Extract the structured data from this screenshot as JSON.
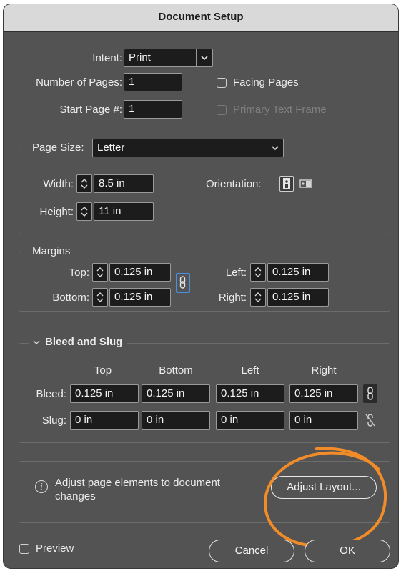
{
  "title": "Document Setup",
  "intent": {
    "label": "Intent:",
    "value": "Print"
  },
  "pages": {
    "label": "Number of Pages:",
    "value": "1"
  },
  "start_page": {
    "label": "Start Page #:",
    "value": "1"
  },
  "facing_pages": {
    "label": "Facing Pages",
    "checked": false
  },
  "primary_text_frame": {
    "label": "Primary Text Frame",
    "checked": false,
    "enabled": false
  },
  "page_size": {
    "label": "Page Size:",
    "value": "Letter"
  },
  "width": {
    "label": "Width:",
    "value": "8.5 in"
  },
  "height": {
    "label": "Height:",
    "value": "11 in"
  },
  "orientation": {
    "label": "Orientation:",
    "selected": "portrait"
  },
  "margins": {
    "legend": "Margins",
    "top": {
      "label": "Top:",
      "value": "0.125 in"
    },
    "bottom": {
      "label": "Bottom:",
      "value": "0.125 in"
    },
    "left": {
      "label": "Left:",
      "value": "0.125 in"
    },
    "right": {
      "label": "Right:",
      "value": "0.125 in"
    },
    "linked": true
  },
  "bleed_slug": {
    "legend": "Bleed and Slug",
    "columns": [
      "Top",
      "Bottom",
      "Left",
      "Right"
    ],
    "bleed": {
      "label": "Bleed:",
      "values": [
        "0.125 in",
        "0.125 in",
        "0.125 in",
        "0.125 in"
      ],
      "linked": true
    },
    "slug": {
      "label": "Slug:",
      "values": [
        "0 in",
        "0 in",
        "0 in",
        "0 in"
      ],
      "linked": false
    }
  },
  "adjust": {
    "info_line1": "Adjust page elements to document",
    "info_line2": "changes",
    "button": "Adjust Layout..."
  },
  "preview": {
    "label": "Preview",
    "checked": false
  },
  "buttons": {
    "cancel": "Cancel",
    "ok": "OK"
  },
  "colors": {
    "dialog_bg": "#535353",
    "field_bg": "#1c1c1c",
    "accent": "#4a90e2",
    "highlight": "#f28c28"
  }
}
